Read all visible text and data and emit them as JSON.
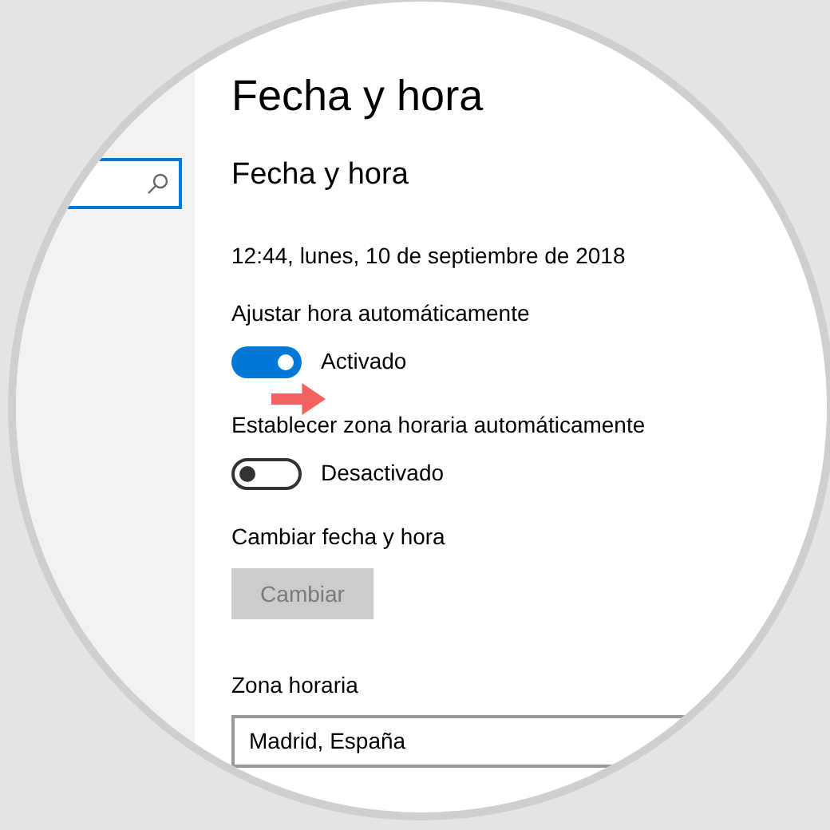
{
  "page_title": "Fecha y hora",
  "section_title": "Fecha y hora",
  "current_datetime": "12:44, lunes, 10 de septiembre de 2018",
  "toggles": [
    {
      "label": "Ajustar hora automáticamente",
      "on": true,
      "state_text": "Activado"
    },
    {
      "label": "Establecer zona horaria automáticamente",
      "on": false,
      "state_text": "Desactivado"
    }
  ],
  "change_date": {
    "label": "Cambiar fecha y hora",
    "button": {
      "label": "Cambiar",
      "disabled": true
    }
  },
  "time_zone": {
    "label": "Zona horaria",
    "value": "Madrid, España"
  }
}
